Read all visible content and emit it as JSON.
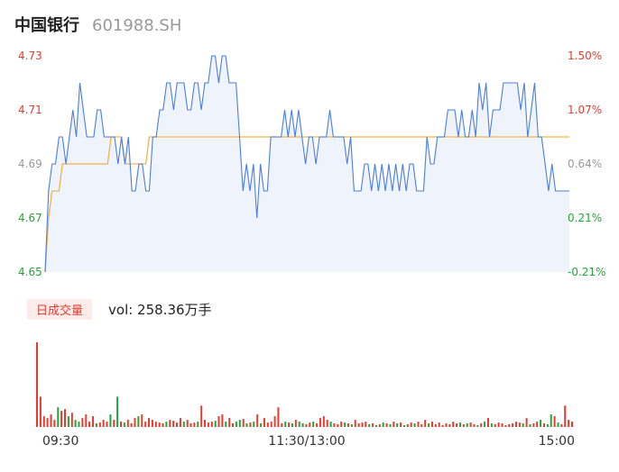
{
  "header": {
    "name": "中国银行",
    "code": "601988.SH"
  },
  "colors": {
    "price_line": "#4a7fe0",
    "avg_line": "#f0b44c",
    "area_fill": "#eef3fc",
    "up": "#e63b2e",
    "down": "#22a537",
    "neutral": "#999999"
  },
  "volume": {
    "badge": "日成交量",
    "text": "vol: 258.36万手"
  },
  "chart_data": [
    {
      "type": "line",
      "title": "",
      "series_desc": "intraday price and average price",
      "y_ticks_left": [
        "4.73",
        "4.71",
        "4.69",
        "4.67",
        "4.65"
      ],
      "y_ticks_right": [
        "1.50%",
        "1.07%",
        "0.64%",
        "0.21%",
        "-0.21%"
      ],
      "ylim": [
        4.65,
        4.73
      ],
      "x_ticks": [
        "09:30",
        "11:30/13:00",
        "15:00"
      ],
      "price": [
        4.65,
        4.68,
        4.69,
        4.69,
        4.7,
        4.7,
        4.69,
        4.7,
        4.71,
        4.7,
        4.72,
        4.71,
        4.7,
        4.7,
        4.7,
        4.71,
        4.71,
        4.7,
        4.7,
        4.7,
        4.7,
        4.69,
        4.7,
        4.69,
        4.7,
        4.68,
        4.68,
        4.69,
        4.69,
        4.68,
        4.68,
        4.7,
        4.7,
        4.71,
        4.71,
        4.72,
        4.72,
        4.71,
        4.72,
        4.72,
        4.72,
        4.71,
        4.71,
        4.72,
        4.72,
        4.71,
        4.72,
        4.72,
        4.73,
        4.73,
        4.72,
        4.73,
        4.73,
        4.72,
        4.72,
        4.72,
        4.7,
        4.68,
        4.69,
        4.68,
        4.69,
        4.67,
        4.69,
        4.68,
        4.68,
        4.7,
        4.7,
        4.7,
        4.7,
        4.71,
        4.7,
        4.71,
        4.7,
        4.71,
        4.7,
        4.69,
        4.7,
        4.7,
        4.69,
        4.7,
        4.7,
        4.7,
        4.71,
        4.7,
        4.7,
        4.7,
        4.7,
        4.69,
        4.7,
        4.68,
        4.68,
        4.68,
        4.69,
        4.69,
        4.68,
        4.69,
        4.68,
        4.69,
        4.68,
        4.69,
        4.68,
        4.69,
        4.68,
        4.69,
        4.68,
        4.69,
        4.69,
        4.68,
        4.68,
        4.68,
        4.7,
        4.69,
        4.69,
        4.7,
        4.7,
        4.7,
        4.71,
        4.71,
        4.71,
        4.7,
        4.71,
        4.7,
        4.7,
        4.71,
        4.7,
        4.72,
        4.71,
        4.72,
        4.7,
        4.71,
        4.71,
        4.71,
        4.72,
        4.72,
        4.72,
        4.72,
        4.72,
        4.71,
        4.72,
        4.7,
        4.71,
        4.72,
        4.7,
        4.7,
        4.69,
        4.68,
        4.69,
        4.68,
        4.68,
        4.68,
        4.68,
        4.68
      ],
      "avg": [
        4.65,
        4.67,
        4.68,
        4.68,
        4.68,
        4.69,
        4.69,
        4.69,
        4.69,
        4.69,
        4.69,
        4.69,
        4.69,
        4.69,
        4.69,
        4.69,
        4.69,
        4.69,
        4.69,
        4.7,
        4.7,
        4.7,
        4.7,
        4.69,
        4.69,
        4.69,
        4.69,
        4.69,
        4.69,
        4.69,
        4.7,
        4.7,
        4.7,
        4.7,
        4.7,
        4.7,
        4.7,
        4.7,
        4.7,
        4.7,
        4.7,
        4.7,
        4.7,
        4.7,
        4.7,
        4.7,
        4.7,
        4.7,
        4.7,
        4.7,
        4.7,
        4.7,
        4.7,
        4.7,
        4.7,
        4.7,
        4.7,
        4.7,
        4.7,
        4.7,
        4.7,
        4.7,
        4.7,
        4.7,
        4.7,
        4.7,
        4.7,
        4.7,
        4.7,
        4.7,
        4.7,
        4.7,
        4.7,
        4.7,
        4.7,
        4.7,
        4.7,
        4.7,
        4.7,
        4.7,
        4.7,
        4.7,
        4.7,
        4.7,
        4.7,
        4.7,
        4.7,
        4.7,
        4.7,
        4.7,
        4.7,
        4.7,
        4.7,
        4.7,
        4.7,
        4.7,
        4.7,
        4.7,
        4.7,
        4.7,
        4.7,
        4.7,
        4.7,
        4.7,
        4.7,
        4.7,
        4.7,
        4.7,
        4.7,
        4.7,
        4.7,
        4.7,
        4.7,
        4.7,
        4.7,
        4.7,
        4.7,
        4.7,
        4.7,
        4.7,
        4.7,
        4.7,
        4.7,
        4.7,
        4.7,
        4.7,
        4.7,
        4.7,
        4.7,
        4.7,
        4.7,
        4.7,
        4.7,
        4.7,
        4.7,
        4.7,
        4.7,
        4.7,
        4.7,
        4.7,
        4.7,
        4.7,
        4.7,
        4.7,
        4.7,
        4.7,
        4.7,
        4.7,
        4.7,
        4.7,
        4.7,
        4.7
      ],
      "volume": [
        95,
        34,
        12,
        10,
        14,
        8,
        22,
        18,
        20,
        12,
        16,
        8,
        6,
        10,
        14,
        6,
        12,
        4,
        5,
        8,
        6,
        14,
        8,
        34,
        6,
        5,
        8,
        4,
        10,
        12,
        14,
        6,
        10,
        8,
        6,
        5,
        4,
        6,
        8,
        7,
        5,
        10,
        6,
        8,
        4,
        5,
        6,
        24,
        8,
        5,
        6,
        7,
        12,
        14,
        6,
        10,
        4,
        6,
        8,
        9,
        4,
        5,
        6,
        14,
        4,
        10,
        5,
        6,
        12,
        22,
        4,
        6,
        5,
        4,
        8,
        6,
        4,
        3,
        5,
        6,
        4,
        10,
        12,
        8,
        6,
        4,
        3,
        6,
        5,
        4,
        3,
        8,
        4,
        5,
        6,
        3,
        4,
        2,
        3,
        5,
        4,
        3,
        6,
        4,
        5,
        2,
        3,
        5,
        4,
        6,
        3,
        8,
        4,
        6,
        3,
        5,
        2,
        4,
        3,
        6,
        4,
        5,
        3,
        4,
        5,
        3,
        2,
        4,
        6,
        10,
        4,
        3,
        5,
        4,
        2,
        3,
        4,
        6,
        5,
        4,
        10,
        3,
        4,
        6,
        8,
        4,
        3,
        14,
        12,
        5,
        3,
        24,
        8,
        6
      ]
    }
  ]
}
